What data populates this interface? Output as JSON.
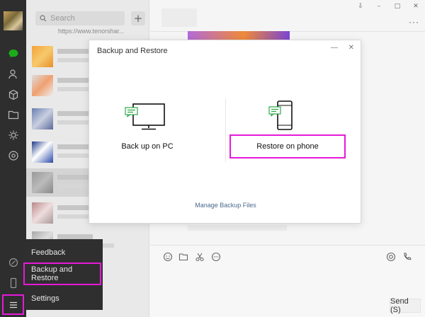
{
  "sidebar": {
    "search_placeholder": "Search",
    "add_label": "+",
    "url_preview": "https://www.tenorshar..."
  },
  "topbar": {
    "pin": "⇩",
    "minimize": "–",
    "maximize": "□",
    "close": "✕",
    "more": "···"
  },
  "dialog": {
    "title": "Backup and Restore",
    "minimize": "—",
    "close": "✕",
    "backup_label": "Back up on PC",
    "restore_label": "Restore on phone",
    "manage_link": "Manage Backup Files"
  },
  "menu": {
    "items": [
      {
        "label": "Feedback"
      },
      {
        "label": "Backup and Restore"
      },
      {
        "label": "Settings"
      }
    ]
  },
  "composer": {
    "send_label": "Send (S)"
  },
  "colors": {
    "highlight": "#e619d9",
    "rail": "#2e2e2e",
    "chat_active": "#1aad19"
  }
}
